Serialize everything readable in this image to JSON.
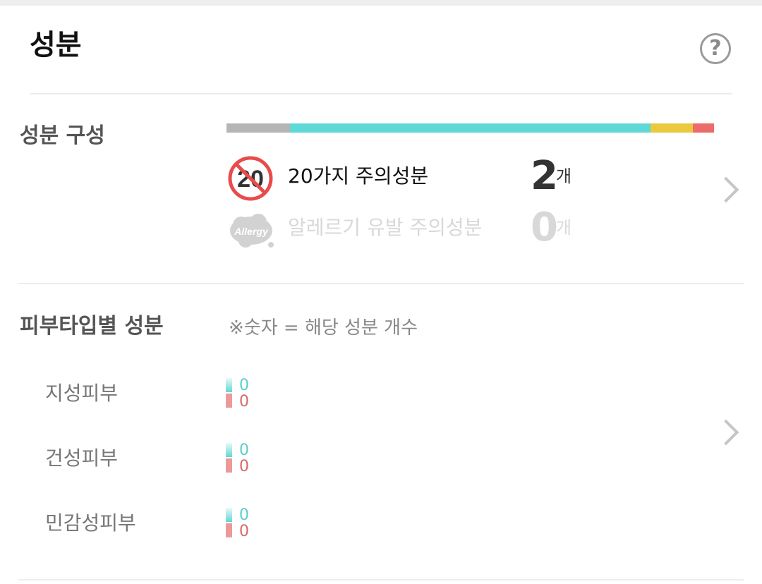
{
  "header": {
    "title": "성분",
    "help_icon": "question-circle-icon",
    "help_glyph": "?"
  },
  "composition": {
    "title": "성분 구성",
    "segments": [
      {
        "name": "gray",
        "fraction": 0.13,
        "color": "#b5b5b5"
      },
      {
        "name": "teal",
        "fraction": 0.74,
        "color": "#5ed9d5"
      },
      {
        "name": "yellow",
        "fraction": 0.087,
        "color": "#ebc93f"
      },
      {
        "name": "red",
        "fraction": 0.043,
        "color": "#ec6c6c"
      }
    ],
    "rows": [
      {
        "icon": "no-20-icon",
        "icon_text": "20",
        "label": "20가지 주의성분",
        "count": "2",
        "unit": "개"
      },
      {
        "icon": "allergy-cloud-icon",
        "icon_text": "Allergy",
        "label": "알레르기 유발 주의성분",
        "count": "0",
        "unit": "개"
      }
    ]
  },
  "skin_types": {
    "title": "피부타입별 성분",
    "note": "※숫자 = 해당 성분 개수",
    "rows": [
      {
        "label": "지성피부",
        "good": "0",
        "bad": "0"
      },
      {
        "label": "건성피부",
        "good": "0",
        "bad": "0"
      },
      {
        "label": "민감성피부",
        "good": "0",
        "bad": "0"
      }
    ]
  },
  "colors": {
    "accent_teal": "#5ed9d5",
    "warn_red": "#e94b4b",
    "warn_yellow": "#ebc93f"
  }
}
